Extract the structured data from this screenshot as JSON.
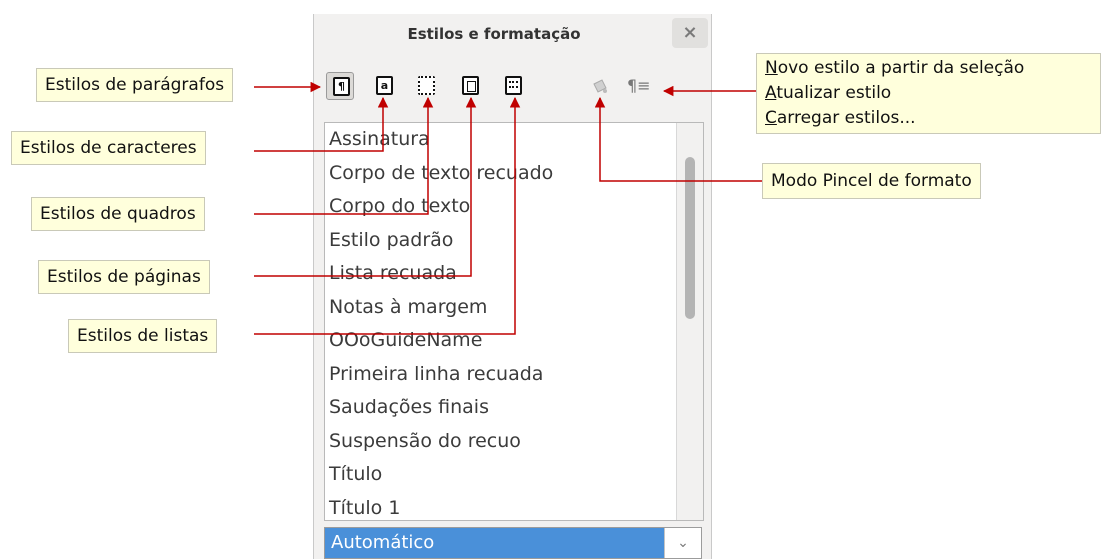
{
  "window": {
    "title": "Estilos e formatação",
    "close_icon": "close-icon"
  },
  "toolbar": {
    "buttons": [
      {
        "name": "paragraph-styles-button",
        "glyph": "¶",
        "icon": "paragraph-icon"
      },
      {
        "name": "character-styles-button",
        "glyph": "a",
        "icon": "character-icon"
      },
      {
        "name": "frame-styles-button",
        "glyph": "",
        "icon": "frame-icon"
      },
      {
        "name": "page-styles-button",
        "glyph": "",
        "icon": "page-icon"
      },
      {
        "name": "list-styles-button",
        "glyph": "",
        "icon": "list-icon"
      }
    ],
    "fill_format_icon": "bucket-icon",
    "new_style_icon": "¶≡"
  },
  "styles_list": [
    "Assinatura",
    "Corpo de texto recuado",
    "Corpo do texto",
    "Estilo padrão",
    "Lista recuada",
    "Notas à margem",
    "OOoGuideName",
    "Primeira linha recuada",
    "Saudações finais",
    "Suspensão do recuo",
    "Título",
    "Título 1"
  ],
  "filter": {
    "selected": "Automático"
  },
  "callouts": {
    "paragraph": "Estilos de parágrafos",
    "character": "Estilos de caracteres",
    "frame": "Estilos de quadros",
    "page": "Estilos de páginas",
    "list": "Estilos de listas",
    "fill_format": "Modo Pincel de formato",
    "new_style_menu": {
      "new_from_selection": {
        "first": "N",
        "rest": "ovo estilo a partir da seleção"
      },
      "update_style": {
        "first": "A",
        "rest": "tualizar estilo"
      },
      "load_styles": {
        "first": "C",
        "rest": "arregar estilos..."
      }
    }
  },
  "colors": {
    "arrow": "#c00000",
    "selection": "#4a90d9",
    "callout_bg": "#ffffdc"
  }
}
